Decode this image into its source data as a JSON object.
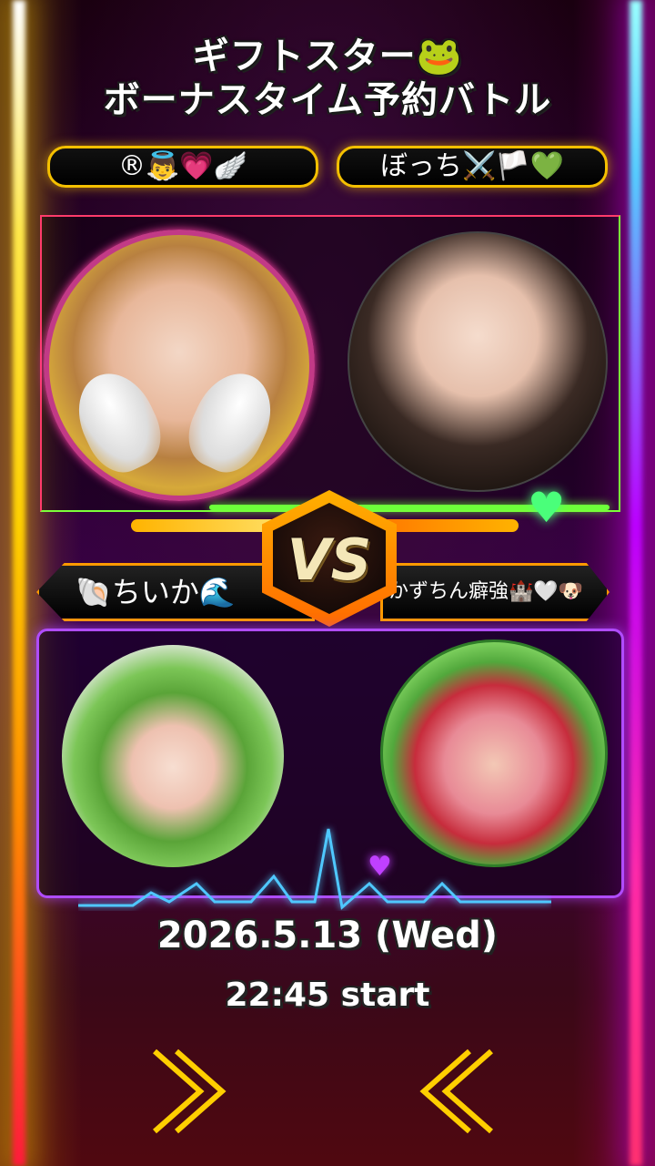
{
  "title": {
    "line1": "ギフトスター🐸",
    "line2": "ボーナスタイム予約バトル"
  },
  "top_names": {
    "left": "®👼💗🪽",
    "right": "ぼっち⚔️🏳️💚"
  },
  "vs": {
    "label": "VS",
    "left_name": "🐚ちいか🌊",
    "right_name": "かずちん癖強🏰🤍🐶🦔"
  },
  "schedule": {
    "date": "2026.5.13 (Wed)",
    "time": "22:45 start"
  },
  "colors": {
    "neon_left": "#ffd000",
    "neon_right": "#ff2aa8",
    "pill_border": "#f5c000",
    "vs_frame": "#ff9a00",
    "bottom_frame": "#b04cff",
    "accent_green": "#6dff3a"
  },
  "icons": [
    "angel-wings-icon",
    "heart-icon",
    "chevron-right-icon",
    "chevron-left-icon",
    "heartbeat-line-icon"
  ]
}
